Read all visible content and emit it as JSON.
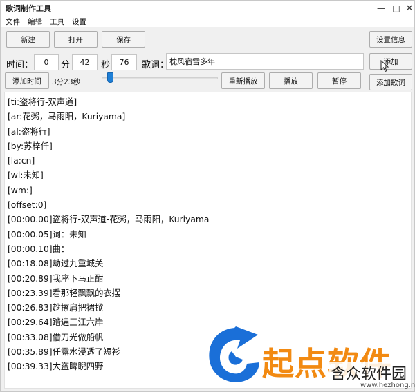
{
  "window": {
    "title": "歌词制作工具",
    "min_glyph": "—",
    "max_glyph": "□",
    "close_glyph": "✕"
  },
  "menu": [
    "文件",
    "编辑",
    "工具",
    "设置"
  ],
  "toolbar": {
    "new": "新建",
    "open": "打开",
    "save": "保存",
    "settings": "设置信息"
  },
  "time": {
    "label": "时间：",
    "min_label": "分",
    "sec_label": "秒",
    "minutes": "0",
    "seconds": "42",
    "hundredths": "76"
  },
  "lyric_input": {
    "label": "歌词：",
    "value": "枕风宿雪多年"
  },
  "buttons": {
    "add": "添加",
    "add_time": "添加时间",
    "replay": "重新播放",
    "play": "播放",
    "pause": "暂停",
    "add_lyric": "添加歌词"
  },
  "playback": {
    "elapsed": "3分23秒",
    "progress": 0.05
  },
  "lyrics": [
    "[ti:盗将行-双声道]",
    "[ar:花粥，马雨阳，Kuriyama]",
    "[al:盗将行]",
    "[by:苏梓仟]",
    "[la:cn]",
    "[wl:未知]",
    "[wm:]",
    "[offset:0]",
    "[00:00.00]盗将行-双声道-花粥，马雨阳，Kuriyama",
    "[00:00.05]词：未知",
    "[00:00.10]曲：",
    "[00:18.08]劫过九重城关",
    "[00:20.89]我座下马正酣",
    "[00:23.39]看那轻飘飘的衣摆",
    "[00:26.83]趁擦肩把裙掀",
    "[00:29.64]踏遍三江六岸",
    "[00:33.08]借刀光做船帆",
    "[00:35.89]任露水浸透了短衫",
    "[00:39.33]大盗睥睨四野"
  ],
  "watermark": {
    "brand": "起点软件",
    "site_name": "含众软件园",
    "site_url": "www.hezhong.net"
  },
  "colors": {
    "accent": "#1e7fd6",
    "watermark_orange": "#f28a12",
    "watermark_blue": "#1a6fd8"
  }
}
